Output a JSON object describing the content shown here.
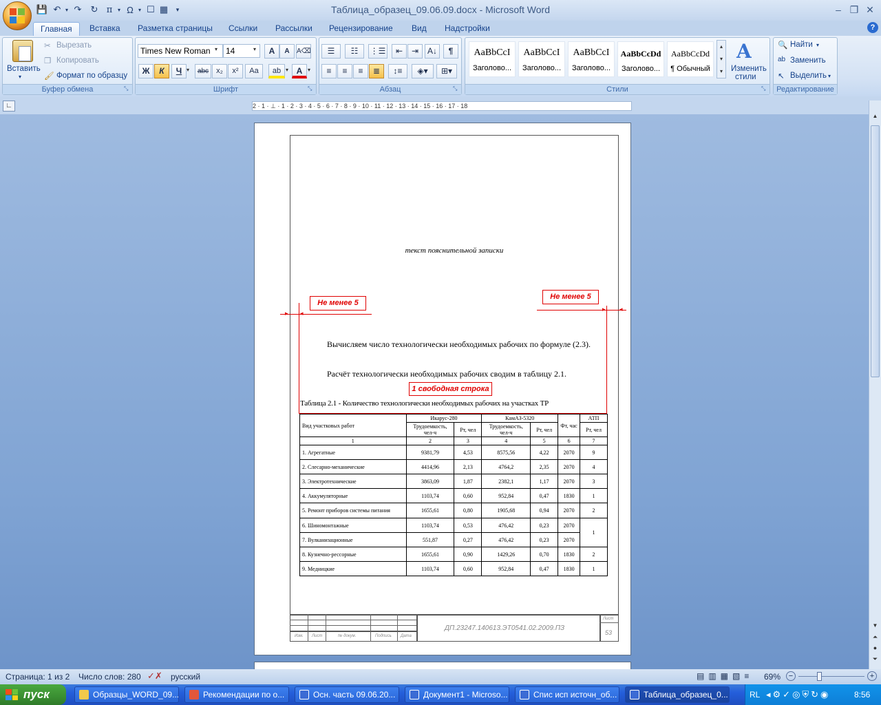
{
  "window": {
    "title": "Таблица_образец_09.06.09.docx - Microsoft Word"
  },
  "qat": [
    "💾",
    "↶",
    "↷",
    "π",
    "Ω"
  ],
  "tabs": [
    {
      "label": "Главная",
      "active": true
    },
    {
      "label": "Вставка"
    },
    {
      "label": "Разметка страницы"
    },
    {
      "label": "Ссылки"
    },
    {
      "label": "Рассылки"
    },
    {
      "label": "Рецензирование"
    },
    {
      "label": "Вид"
    },
    {
      "label": "Надстройки"
    }
  ],
  "clipboard": {
    "title": "Буфер обмена",
    "paste": "Вставить",
    "cut": "Вырезать",
    "copy": "Копировать",
    "format_painter": "Формат по образцу"
  },
  "font": {
    "title": "Шрифт",
    "name": "Times New Roman",
    "size": "14",
    "bold": "Ж",
    "italic": "К",
    "underline": "Ч",
    "strike": "abc",
    "sub": "x₂",
    "sup": "x²",
    "case": "Aa"
  },
  "paragraph": {
    "title": "Абзац"
  },
  "styles": {
    "title": "Стили",
    "items": [
      {
        "sample": "AaBbCcI",
        "name": "Заголово..."
      },
      {
        "sample": "AaBbCcI",
        "name": "Заголово..."
      },
      {
        "sample": "AaBbCcI",
        "name": "Заголово..."
      },
      {
        "sample": "AaBbCcDd",
        "name": "Заголово..."
      },
      {
        "sample": "AaBbCcDd",
        "name": "¶ Обычный"
      }
    ],
    "change_line1": "Изменить",
    "change_line2": "стили"
  },
  "editing": {
    "title": "Редактирование",
    "find": "Найти",
    "replace": "Заменить",
    "select": "Выделить"
  },
  "ruler": "2 · 1 · ⊥ · 1 · 2 · 3 · 4 · 5 · 6 · 7 · 8 · 9 · 10 · 11 · 12 · 13 · 14 · 15 · 16 · 17 · 18",
  "doc": {
    "placeholder": "текст пояснительной записки",
    "note_left": "Не менее 5",
    "note_right": "Не менее 5",
    "para1": "Вычисляем число технологически необходимых рабочих по формуле (2.3).",
    "para2": "Расчёт технологически необходимых рабочих сводим в таблицу 2.1.",
    "free_line": "1 свободная строка",
    "table_caption": "Таблица 2.1 - Количество технологически необходимых рабочих на участках ТР",
    "table": {
      "h_work": "Вид участковых работ",
      "h_ikarus": "Икарус-280",
      "h_kamaz": "КамАЗ-5320",
      "h_labor": "Трудоемкость, чел-ч",
      "h_pt": "Рт, чел",
      "h_fund": "Фт, час",
      "h_atp": "АТП",
      "nums": [
        "1",
        "2",
        "3",
        "4",
        "5",
        "6",
        "7"
      ],
      "rows": [
        [
          "1. Агрегатные",
          "9381,79",
          "4,53",
          "8575,56",
          "4,22",
          "2070",
          "9"
        ],
        [
          "2. Слесарно-механические",
          "4414,96",
          "2,13",
          "4764,2",
          "2,35",
          "2070",
          "4"
        ],
        [
          "3. Электротехнические",
          "3863,09",
          "1,87",
          "2382,1",
          "1,17",
          "2070",
          "3"
        ],
        [
          "4. Аккумуляторные",
          "1103,74",
          "0,60",
          "952,84",
          "0,47",
          "1830",
          "1"
        ],
        [
          "5. Ремонт приборов системы питания",
          "1655,61",
          "0,80",
          "1905,68",
          "0,94",
          "2070",
          "2"
        ],
        [
          "6. Шиномонтажные",
          "1103,74",
          "0,53",
          "476,42",
          "0,23",
          "2070",
          "1"
        ],
        [
          "7. Вулканизационные",
          "551,87",
          "0,27",
          "476,42",
          "0,23",
          "2070",
          ""
        ],
        [
          "8. Кузнечно-рессорные",
          "1655,61",
          "0,90",
          "1429,26",
          "0,70",
          "1830",
          "2"
        ],
        [
          "9. Медницкие",
          "1103,74",
          "0,60",
          "952,84",
          "0,47",
          "1830",
          "1"
        ]
      ]
    },
    "stamp_code": "ДП.23247.140613.ЭТ0541.02.2009.ПЗ",
    "stamp_sheet": "Лист",
    "stamp_page": "53",
    "stamp_cols": [
      "Изм.",
      "Лист",
      "№ докум.",
      "Подпись",
      "Дата"
    ]
  },
  "status": {
    "page": "Страница: 1 из 2",
    "words": "Число слов: 280",
    "lang": "русский",
    "zoom": "69%"
  },
  "taskbar": {
    "start": "пуск",
    "tasks": [
      {
        "label": "Образцы_WORD_09...."
      },
      {
        "label": "Рекомендации по о..."
      },
      {
        "label": "Осн. часть 09.06.20..."
      },
      {
        "label": "Документ1 - Microso..."
      },
      {
        "label": "Спис исп источн_об..."
      },
      {
        "label": "Таблица_образец_0...",
        "active": true
      }
    ],
    "lang": "RL",
    "time": "8:56"
  },
  "colors": {
    "accent": "#15428b",
    "red": "#e00000",
    "taskbar": "#245edb"
  }
}
